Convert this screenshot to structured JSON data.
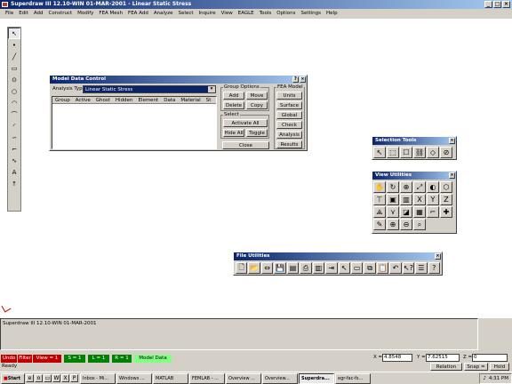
{
  "app": {
    "title": "Superdraw III 12.10-WIN 01-MAR-2001 - Linear Static Stress",
    "menu": [
      "File",
      "Edit",
      "Add",
      "Construct",
      "Modify",
      "FEA Mesh",
      "FEA Add",
      "Analyze",
      "Select",
      "Inquire",
      "View",
      "EAGLE",
      "Tools",
      "Options",
      "Settings",
      "Help"
    ]
  },
  "left_tools": [
    "pointer-icon",
    "dot-icon",
    "line-icon",
    "rectangle-icon",
    "circle-center-icon",
    "circle-icon",
    "arc-icon",
    "arc-3pt-icon",
    "arc-tangent-icon",
    "spline-icon",
    "fillet-icon",
    "curve-icon",
    "text-icon",
    "arrow-up-icon"
  ],
  "mdc": {
    "title": "Model Data Control",
    "analysis_label": "Analysis Type",
    "analysis_value": "Linear Static Stress",
    "columns": [
      "Group",
      "Active",
      "Ghost",
      "Hidden",
      "Element",
      "Data",
      "Material",
      "St"
    ],
    "group_options": {
      "label": "Group Options",
      "add": "Add",
      "move": "Move",
      "delete": "Delete",
      "copy": "Copy"
    },
    "select": {
      "label": "Select",
      "activate_all": "Activate All",
      "hide_all": "Hide All",
      "toggle": "Toggle"
    },
    "fea_model": {
      "label": "FEA Model",
      "units": "Units",
      "surface": "Surface",
      "global": "Global",
      "check": "Check",
      "analysis": "Analysis",
      "results": "Results"
    },
    "close": "Close"
  },
  "selection_tools": {
    "title": "Selection Tools"
  },
  "view_utilities": {
    "title": "View Utilities"
  },
  "file_utilities": {
    "title": "File Utilities"
  },
  "console": {
    "text": "Superdraw III 12.10-WIN 01-MAR-2001"
  },
  "status": {
    "undo": "Undo",
    "filter": "Filter",
    "view": "View = 1",
    "s": "S = 1",
    "l": "L = 1",
    "r": "R = 1",
    "model_data": "Model Data",
    "ready": "Ready",
    "x_label": "X =",
    "x_value": "4.8548",
    "y_label": "Y =",
    "y_value": "7.62515",
    "z_label": "Z =",
    "z_value": "0",
    "relation": "Relation",
    "snap": "Snap = N",
    "hold": "Hold"
  },
  "taskbar": {
    "start": "Start",
    "tasks": [
      "Inbox - Mi...",
      "Windows ...",
      "MATLAB",
      "FEMLAB - ...",
      "Overview ...",
      "Overview...",
      "Superdra...",
      "egr-fac-fs..."
    ],
    "clock": "4:31 PM"
  },
  "colors": {
    "titlebar": "#0a246a",
    "undo": "#c00000",
    "status_green": "#008000",
    "model_data": "#80ff80"
  }
}
